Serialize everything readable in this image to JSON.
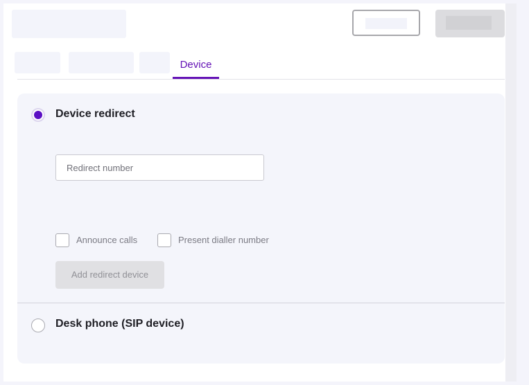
{
  "tabs": {
    "active_label": "Device"
  },
  "device_redirect": {
    "label": "Device redirect",
    "selected": true,
    "redirect_number": {
      "value": "",
      "placeholder": "Redirect number"
    },
    "announce_calls": {
      "label": "Announce calls",
      "checked": false
    },
    "present_dialler_number": {
      "label": "Present dialler number",
      "checked": false
    },
    "add_button_label": "Add redirect device"
  },
  "desk_phone": {
    "label": "Desk phone (SIP device)",
    "selected": false
  },
  "colors": {
    "accent": "#6412b6",
    "radio_selected": "#5b10c4",
    "panel_background": "#f4f5fb",
    "disabled_button": "#e0e0e3"
  }
}
